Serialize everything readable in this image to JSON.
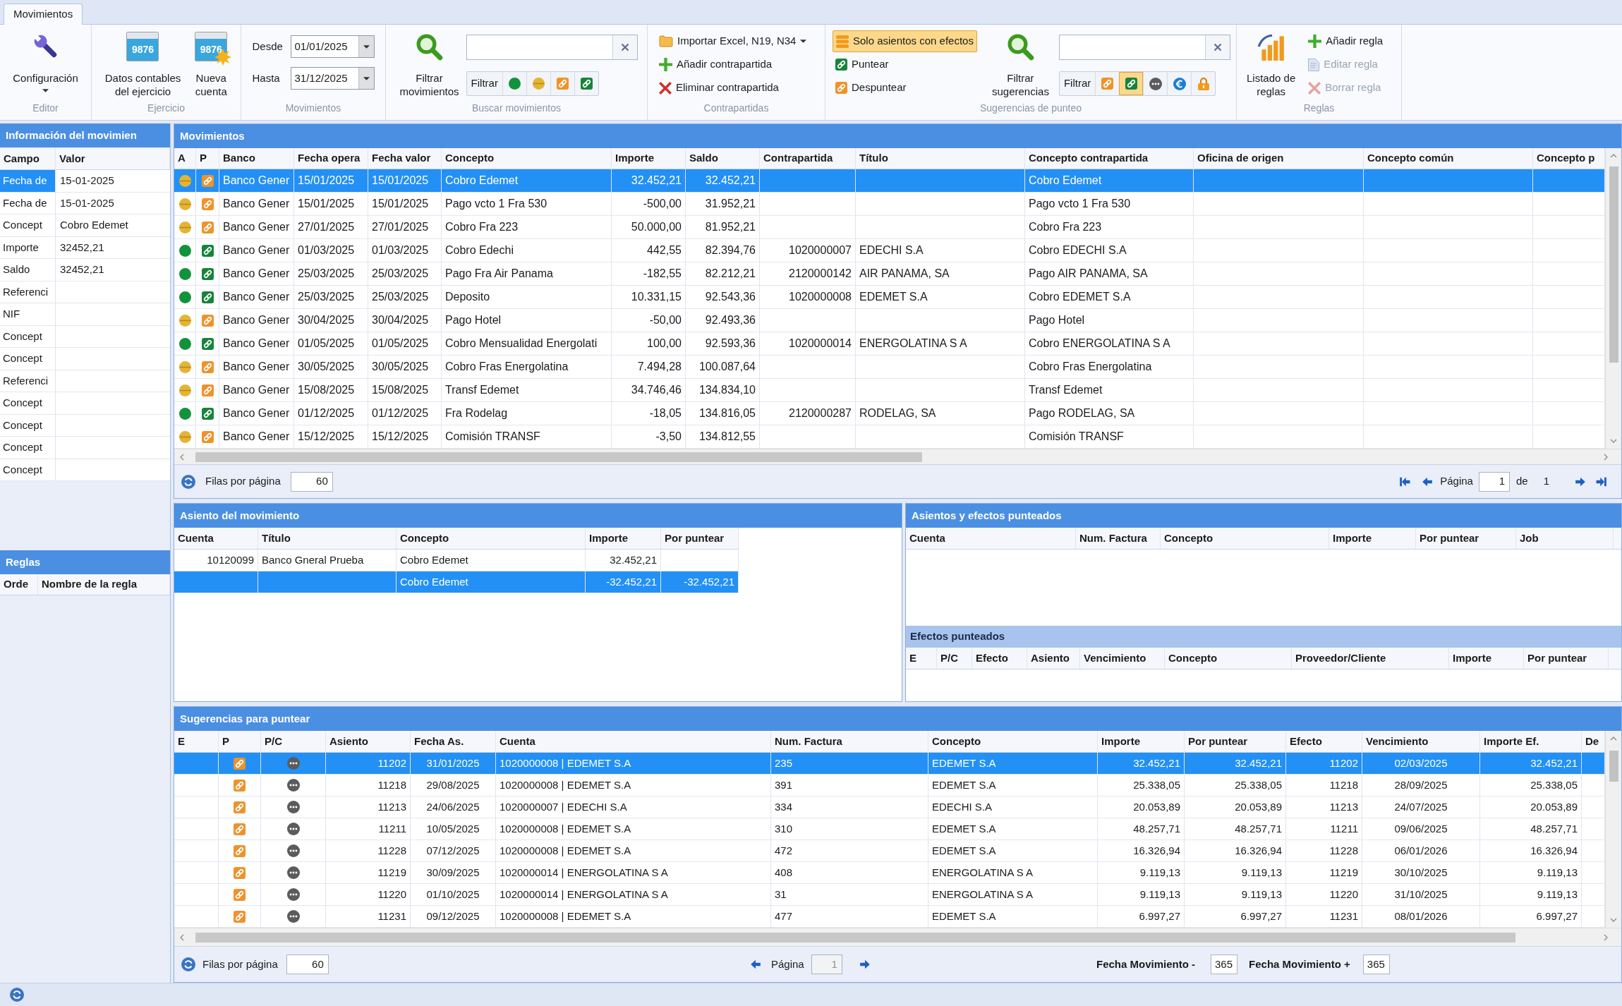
{
  "tabs": [
    {
      "label": "Movimientos",
      "selected": true
    }
  ],
  "ribbon": {
    "editor": {
      "label": "Editor",
      "button": "Configuración"
    },
    "ejercicio": {
      "label": "Ejercicio",
      "buttons": [
        {
          "kind": "data",
          "label": "Datos contables\ndel ejercicio",
          "display": "9876"
        },
        {
          "kind": "new",
          "label": "Nueva\ncuenta",
          "display": "9876"
        }
      ]
    },
    "movimientos": {
      "label": "Movimientos",
      "dates": [
        {
          "label": "Desde",
          "value": "01/01/2025"
        },
        {
          "label": "Hasta",
          "value": "31/12/2025"
        }
      ]
    },
    "buscar": {
      "label": "Buscar movimientos",
      "button": "Filtrar\nmovimientos",
      "filter_label": "Filtrar",
      "filters": [
        {
          "kind": "dot-ok",
          "selected": false
        },
        {
          "kind": "dot-pending",
          "selected": false
        },
        {
          "kind": "link-pending",
          "selected": false
        },
        {
          "kind": "link-ok",
          "selected": false
        }
      ]
    },
    "contrapartidas": {
      "label": "Contrapartidas",
      "actions": [
        {
          "kind": "import",
          "label": "Importar Excel, N19, N34"
        },
        {
          "kind": "add",
          "label": "Añadir contrapartida"
        },
        {
          "kind": "remove",
          "label": "Eliminar contrapartida"
        }
      ]
    },
    "sugerencias": {
      "label": "Sugerencias de punteo",
      "solo_efectos": {
        "label": "Solo asientos con efectos",
        "selected": true
      },
      "actions": [
        {
          "kind": "link-ok",
          "label": "Puntear"
        },
        {
          "kind": "link-pending",
          "label": "Despuntear"
        }
      ],
      "button": "Filtrar\nsugerencias",
      "filter_label": "Filtrar",
      "filters": [
        {
          "kind": "link-pending",
          "selected": false
        },
        {
          "kind": "link-ok",
          "selected": true
        },
        {
          "kind": "ellipsis",
          "selected": false
        },
        {
          "kind": "euro",
          "selected": false
        },
        {
          "kind": "lock",
          "selected": false
        }
      ]
    },
    "reglas": {
      "label": "Reglas",
      "button": "Listado de\nreglas",
      "actions": [
        {
          "kind": "add",
          "label": "Añadir regla",
          "disabled": false
        },
        {
          "kind": "edit",
          "label": "Editar regla",
          "disabled": true
        },
        {
          "kind": "remove",
          "label": "Borrar regla",
          "disabled": true
        }
      ]
    }
  },
  "info_panel": {
    "title": "Información del movimien",
    "columns": [
      "Campo",
      "Valor"
    ],
    "rows": [
      {
        "campo": "Fecha de",
        "valor": "15-01-2025",
        "selected": true
      },
      {
        "campo": "Fecha de",
        "valor": "15-01-2025",
        "selected": false
      },
      {
        "campo": "Concept",
        "valor": "Cobro Edemet",
        "selected": false
      },
      {
        "campo": "Importe",
        "valor": "32452,21",
        "selected": false
      },
      {
        "campo": "Saldo",
        "valor": "32452,21",
        "selected": false
      },
      {
        "campo": "Referenci",
        "selected": false
      },
      {
        "campo": "NIF",
        "selected": false
      },
      {
        "campo": "Concept",
        "selected": false
      },
      {
        "campo": "Concept",
        "selected": false
      },
      {
        "campo": "Referenci",
        "selected": false
      },
      {
        "campo": "Concept",
        "selected": false
      },
      {
        "campo": "Concept",
        "selected": false
      },
      {
        "campo": "Concept",
        "selected": false
      },
      {
        "campo": "Concept",
        "selected": false
      }
    ]
  },
  "rules_panel": {
    "title": "Reglas",
    "columns": [
      "Orde",
      "Nombre de la regla"
    ]
  },
  "movements": {
    "title": "Movimientos",
    "columns": [
      "A",
      "P",
      "Banco",
      "Fecha opera",
      "Fecha valor",
      "Concepto",
      "Importe",
      "Saldo",
      "Contrapartida",
      "Título",
      "Concepto contrapartida",
      "Oficina de origen",
      "Concepto común",
      "Concepto p"
    ],
    "rows": [
      {
        "asiento_ok": false,
        "punteado": false,
        "banco": "Banco Gener",
        "fecha_operacion": "15/01/2025",
        "fecha_valor": "15/01/2025",
        "concepto": "Cobro Edemet",
        "importe": "32.452,21",
        "saldo": "32.452,21",
        "concepto_contrapartida": "Cobro Edemet",
        "selected": true
      },
      {
        "asiento_ok": false,
        "punteado": false,
        "banco": "Banco Gener",
        "fecha_operacion": "15/01/2025",
        "fecha_valor": "15/01/2025",
        "concepto": "Pago vcto 1 Fra 530",
        "importe": "-500,00",
        "saldo": "31.952,21",
        "concepto_contrapartida": "Pago vcto 1 Fra 530",
        "selected": false
      },
      {
        "asiento_ok": false,
        "punteado": false,
        "banco": "Banco Gener",
        "fecha_operacion": "27/01/2025",
        "fecha_valor": "27/01/2025",
        "concepto": "Cobro Fra 223",
        "importe": "50.000,00",
        "saldo": "81.952,21",
        "concepto_contrapartida": "Cobro Fra 223",
        "selected": false
      },
      {
        "asiento_ok": true,
        "punteado": true,
        "banco": "Banco Gener",
        "fecha_operacion": "01/03/2025",
        "fecha_valor": "01/03/2025",
        "concepto": "Cobro Edechi",
        "importe": "442,55",
        "saldo": "82.394,76",
        "contrapartida": "1020000007",
        "titulo": "EDECHI S.A",
        "concepto_contrapartida": "Cobro EDECHI S.A",
        "selected": false
      },
      {
        "asiento_ok": true,
        "punteado": true,
        "banco": "Banco Gener",
        "fecha_operacion": "25/03/2025",
        "fecha_valor": "25/03/2025",
        "concepto": "Pago Fra Air Panama",
        "importe": "-182,55",
        "saldo": "82.212,21",
        "contrapartida": "2120000142",
        "titulo": "AIR PANAMA, SA",
        "concepto_contrapartida": "Pago AIR PANAMA, SA",
        "selected": false
      },
      {
        "asiento_ok": true,
        "punteado": true,
        "banco": "Banco Gener",
        "fecha_operacion": "25/03/2025",
        "fecha_valor": "25/03/2025",
        "concepto": "Deposito",
        "importe": "10.331,15",
        "saldo": "92.543,36",
        "contrapartida": "1020000008",
        "titulo": "EDEMET S.A",
        "concepto_contrapartida": "Cobro EDEMET S.A",
        "selected": false
      },
      {
        "asiento_ok": false,
        "punteado": false,
        "banco": "Banco Gener",
        "fecha_operacion": "30/04/2025",
        "fecha_valor": "30/04/2025",
        "concepto": "Pago Hotel",
        "importe": "-50,00",
        "saldo": "92.493,36",
        "concepto_contrapartida": "Pago Hotel",
        "selected": false
      },
      {
        "asiento_ok": true,
        "punteado": true,
        "banco": "Banco Gener",
        "fecha_operacion": "01/05/2025",
        "fecha_valor": "01/05/2025",
        "concepto": "Cobro Mensualidad Energolati",
        "importe": "100,00",
        "saldo": "92.593,36",
        "contrapartida": "1020000014",
        "titulo": "ENERGOLATINA S A",
        "concepto_contrapartida": "Cobro ENERGOLATINA S A",
        "selected": false
      },
      {
        "asiento_ok": false,
        "punteado": false,
        "banco": "Banco Gener",
        "fecha_operacion": "30/05/2025",
        "fecha_valor": "30/05/2025",
        "concepto": "Cobro Fras Energolatina",
        "importe": "7.494,28",
        "saldo": "100.087,64",
        "concepto_contrapartida": "Cobro Fras Energolatina",
        "selected": false
      },
      {
        "asiento_ok": false,
        "punteado": false,
        "banco": "Banco Gener",
        "fecha_operacion": "15/08/2025",
        "fecha_valor": "15/08/2025",
        "concepto": "Transf Edemet",
        "importe": "34.746,46",
        "saldo": "134.834,10",
        "concepto_contrapartida": "Transf Edemet",
        "selected": false
      },
      {
        "asiento_ok": true,
        "punteado": true,
        "banco": "Banco Gener",
        "fecha_operacion": "01/12/2025",
        "fecha_valor": "01/12/2025",
        "concepto": "Fra Rodelag",
        "importe": "-18,05",
        "saldo": "134.816,05",
        "contrapartida": "2120000287",
        "titulo": "RODELAG, SA",
        "concepto_contrapartida": "Pago RODELAG, SA",
        "selected": false
      },
      {
        "asiento_ok": false,
        "punteado": false,
        "banco": "Banco Gener",
        "fecha_operacion": "15/12/2025",
        "fecha_valor": "15/12/2025",
        "concepto": "Comisión TRANSF",
        "importe": "-3,50",
        "saldo": "134.812,55",
        "concepto_contrapartida": "Comisión TRANSF",
        "selected": false
      }
    ],
    "pager": {
      "rows_label": "Filas por página",
      "rows_value": "60",
      "page_label": "Página",
      "page": "1",
      "of_label": "de",
      "pages": "1"
    }
  },
  "asiento": {
    "title": "Asiento del movimiento",
    "columns": [
      "Cuenta",
      "Título",
      "Concepto",
      "Importe",
      "Por puntear"
    ],
    "rows": [
      {
        "cuenta": "10120099",
        "titulo": "Banco Gneral Prueba",
        "concepto": "Cobro Edemet",
        "importe": "32.452,21",
        "selected": false
      },
      {
        "concepto": "Cobro Edemet",
        "importe": "-32.452,21",
        "por_puntear": "-32.452,21",
        "selected": true
      }
    ]
  },
  "punteados": {
    "title": "Asientos y efectos punteados",
    "columns": [
      "Cuenta",
      "Num. Factura",
      "Concepto",
      "Importe",
      "Por puntear",
      "Job"
    ]
  },
  "efectos": {
    "title": "Efectos punteados",
    "columns": [
      "E",
      "P/C",
      "Efecto",
      "Asiento",
      "Vencimiento",
      "Concepto",
      "Proveedor/Cliente",
      "Importe",
      "Por puntear"
    ]
  },
  "sugerencias": {
    "title": "Sugerencias para puntear",
    "columns": [
      "E",
      "P",
      "P/C",
      "Asiento",
      "Fecha As.",
      "Cuenta",
      "Num. Factura",
      "Concepto",
      "Importe",
      "Por puntear",
      "Efecto",
      "Vencimiento",
      "Importe Ef.",
      "De"
    ],
    "rows": [
      {
        "punteado": false,
        "pc_pending": true,
        "asiento": "11202",
        "fecha": "31/01/2025",
        "cuenta": "1020000008 | EDEMET S.A",
        "num_factura": "235",
        "concepto": "EDEMET S.A",
        "importe": "32.452,21",
        "por_puntear": "32.452,21",
        "efecto": "11202",
        "vencimiento": "02/03/2025",
        "importe_ef": "32.452,21",
        "selected": true
      },
      {
        "punteado": false,
        "pc_pending": true,
        "asiento": "11218",
        "fecha": "29/08/2025",
        "cuenta": "1020000008 | EDEMET S.A",
        "num_factura": "391",
        "concepto": "EDEMET S.A",
        "importe": "25.338,05",
        "por_puntear": "25.338,05",
        "efecto": "11218",
        "vencimiento": "28/09/2025",
        "importe_ef": "25.338,05",
        "selected": false
      },
      {
        "punteado": false,
        "pc_pending": true,
        "asiento": "11213",
        "fecha": "24/06/2025",
        "cuenta": "1020000007 | EDECHI S.A",
        "num_factura": "334",
        "concepto": "EDECHI S.A",
        "importe": "20.053,89",
        "por_puntear": "20.053,89",
        "efecto": "11213",
        "vencimiento": "24/07/2025",
        "importe_ef": "20.053,89",
        "selected": false
      },
      {
        "punteado": false,
        "pc_pending": true,
        "asiento": "11211",
        "fecha": "10/05/2025",
        "cuenta": "1020000008 | EDEMET S.A",
        "num_factura": "310",
        "concepto": "EDEMET S.A",
        "importe": "48.257,71",
        "por_puntear": "48.257,71",
        "efecto": "11211",
        "vencimiento": "09/06/2025",
        "importe_ef": "48.257,71",
        "selected": false
      },
      {
        "punteado": false,
        "pc_pending": true,
        "asiento": "11228",
        "fecha": "07/12/2025",
        "cuenta": "1020000008 | EDEMET S.A",
        "num_factura": "472",
        "concepto": "EDEMET S.A",
        "importe": "16.326,94",
        "por_puntear": "16.326,94",
        "efecto": "11228",
        "vencimiento": "06/01/2026",
        "importe_ef": "16.326,94",
        "selected": false
      },
      {
        "punteado": false,
        "pc_pending": true,
        "asiento": "11219",
        "fecha": "30/09/2025",
        "cuenta": "1020000014 | ENERGOLATINA S A",
        "num_factura": "408",
        "concepto": "ENERGOLATINA S A",
        "importe": "9.119,13",
        "por_puntear": "9.119,13",
        "efecto": "11219",
        "vencimiento": "30/10/2025",
        "importe_ef": "9.119,13",
        "selected": false
      },
      {
        "punteado": false,
        "pc_pending": true,
        "asiento": "11220",
        "fecha": "01/10/2025",
        "cuenta": "1020000014 | ENERGOLATINA S A",
        "num_factura": "31",
        "concepto": "ENERGOLATINA S A",
        "importe": "9.119,13",
        "por_puntear": "9.119,13",
        "efecto": "11220",
        "vencimiento": "31/10/2025",
        "importe_ef": "9.119,13",
        "selected": false
      },
      {
        "punteado": false,
        "pc_pending": true,
        "asiento": "11231",
        "fecha": "09/12/2025",
        "cuenta": "1020000008 | EDEMET S.A",
        "num_factura": "477",
        "concepto": "EDEMET S.A",
        "importe": "6.997,27",
        "por_puntear": "6.997,27",
        "efecto": "11231",
        "vencimiento": "08/01/2026",
        "importe_ef": "6.997,27",
        "selected": false
      }
    ],
    "pager": {
      "rows_label": "Filas por página",
      "rows_value": "60",
      "page_label": "Página",
      "page": "1",
      "page_disabled": true,
      "fecha_minus_label": "Fecha Movimiento -",
      "fecha_minus": "365",
      "fecha_plus_label": "Fecha Movimiento +",
      "fecha_plus": "365"
    }
  }
}
